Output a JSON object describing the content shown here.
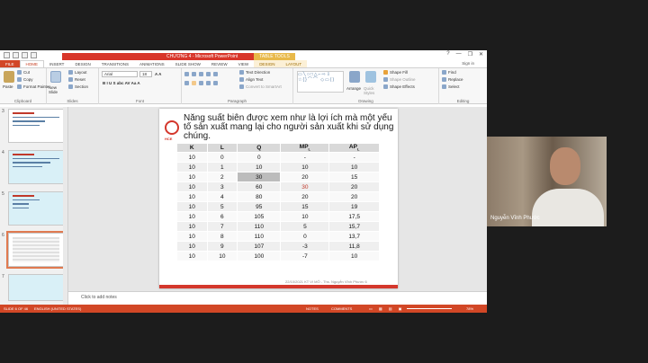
{
  "window": {
    "title": "CHƯƠNG 4 - Microsoft PowerPoint",
    "context_label": "TABLE TOOLS",
    "signin": "Sign in",
    "buttons": [
      "?",
      "—",
      "❐",
      "✕"
    ]
  },
  "tabs": [
    "FILE",
    "HOME",
    "INSERT",
    "DESIGN",
    "TRANSITIONS",
    "ANIMATIONS",
    "SLIDE SHOW",
    "REVIEW",
    "VIEW",
    "DESIGN",
    "LAYOUT"
  ],
  "ribbon": {
    "paste": "Paste",
    "cut": "Cut",
    "copy": "Copy",
    "format_painter": "Format Painter",
    "clipboard": "Clipboard",
    "new_slide": "New Slide",
    "layout": "Layout",
    "reset": "Reset",
    "section": "Section",
    "slides": "Slides",
    "font_name": "Arial",
    "font_size": "18",
    "font": "Font",
    "text_direction": "Text Direction",
    "align_text": "Align Text",
    "convert_smartart": "Convert to SmartArt",
    "paragraph": "Paragraph",
    "arrange": "Arrange",
    "quick_styles": "Quick Styles",
    "drawing": "Drawing",
    "shape_fill": "Shape Fill",
    "shape_outline": "Shape Outline",
    "shape_effects": "Shape Effects",
    "find": "Find",
    "replace": "Replace",
    "select": "Select",
    "editing": "Editing"
  },
  "thumbnails": [
    {
      "num": "3",
      "lines": [
        "Năng suất biên được xem như là lợi ích mà một yếu tố sản xuất mang lại"
      ]
    },
    {
      "num": "4",
      "lines": [
        "SẢN XUẤT TRONG NGẮN HẠN"
      ]
    },
    {
      "num": "5",
      "lines": [
        "CÔNG THỨC TÍNH"
      ]
    },
    {
      "num": "6",
      "lines": [
        ""
      ]
    },
    {
      "num": "7",
      "lines": [
        ""
      ]
    }
  ],
  "slide": {
    "title": "Năng suất biên được xem như là lợi ích mà một yếu tố sản xuất mang lại cho người sản xuất khi sử dụng chúng.",
    "logo": "HCE",
    "footer": "22/10/2021     KT VI MÔ - Ths. Nguyễn Vĩnh Phước     6"
  },
  "table": {
    "headers": [
      "K",
      "L",
      "Q",
      "MP",
      "AP"
    ],
    "subscript": "L",
    "rows": [
      [
        "10",
        "0",
        "0",
        "-",
        "-"
      ],
      [
        "10",
        "1",
        "10",
        "10",
        "10"
      ],
      [
        "10",
        "2",
        "30",
        "20",
        "15"
      ],
      [
        "10",
        "3",
        "60",
        "30",
        "20"
      ],
      [
        "10",
        "4",
        "80",
        "20",
        "20"
      ],
      [
        "10",
        "5",
        "95",
        "15",
        "19"
      ],
      [
        "10",
        "6",
        "105",
        "10",
        "17,5"
      ],
      [
        "10",
        "7",
        "110",
        "5",
        "15,7"
      ],
      [
        "10",
        "8",
        "110",
        "0",
        "13,7"
      ],
      [
        "10",
        "9",
        "107",
        "-3",
        "11,8"
      ],
      [
        "10",
        "10",
        "100",
        "-7",
        "10"
      ]
    ]
  },
  "notes": "Click to add notes",
  "status": {
    "slide": "SLIDE 6 OF 46",
    "lang": "ENGLISH (UNITED STATES)",
    "notes": "NOTES",
    "comments": "COMMENTS",
    "zoom": "78%"
  },
  "video": {
    "name": "Nguyễn Vĩnh Phước"
  }
}
